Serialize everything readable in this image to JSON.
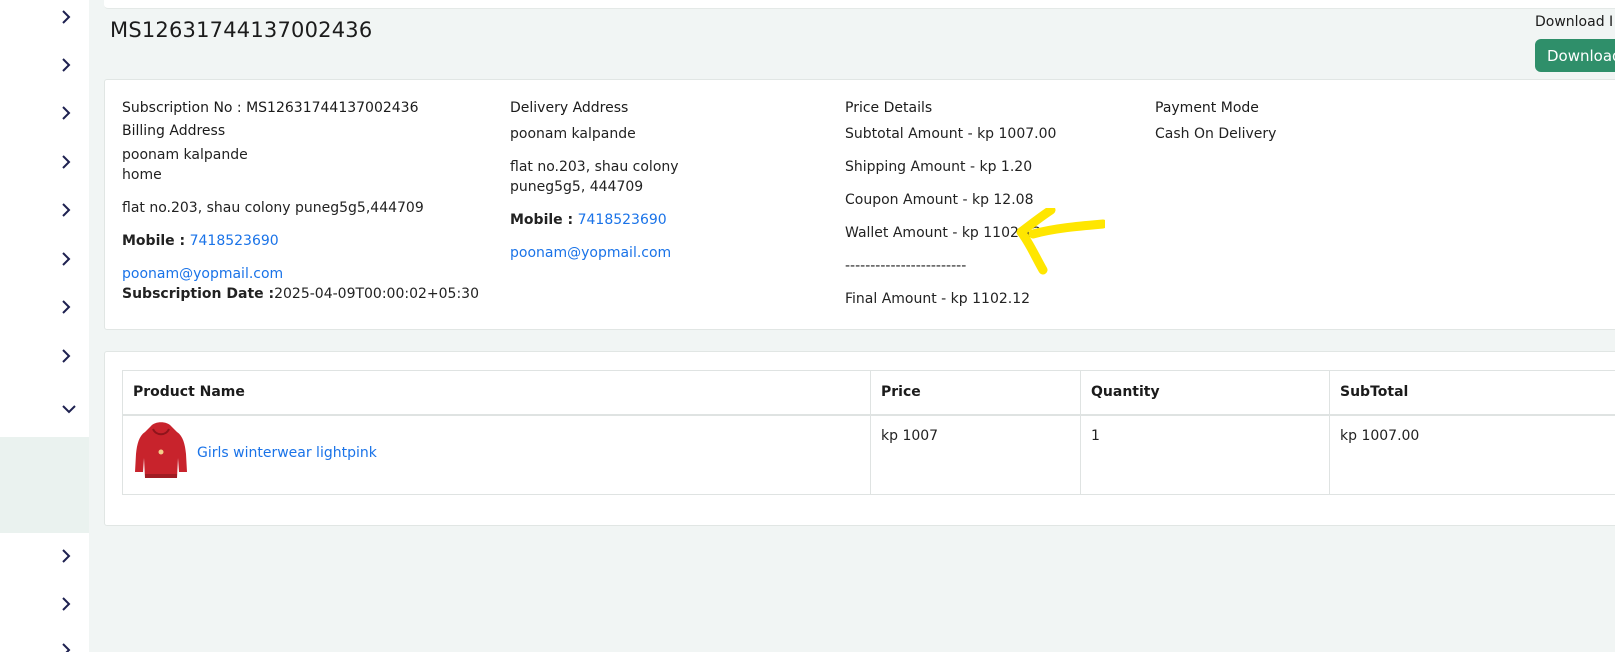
{
  "header": {
    "order_id": "MS12631744137002436",
    "download_label": "Download I",
    "download_button": "Download"
  },
  "billing": {
    "subscription_line": "Subscription No : MS12631744137002436",
    "billing_heading": "Billing Address",
    "name": "poonam kalpande",
    "address_type": "home",
    "address": "flat no.203, shau colony puneg5g5,444709",
    "mobile_label": "Mobile :",
    "mobile": "7418523690",
    "email": "poonam@yopmail.com",
    "date_label": "Subscription Date :",
    "date": "2025-04-09T00:00:02+05:30"
  },
  "delivery": {
    "heading": "Delivery Address",
    "name": "poonam kalpande",
    "address_line1": "flat no.203, shau colony",
    "address_line2": "puneg5g5, 444709",
    "mobile_label": "Mobile :",
    "mobile": "7418523690",
    "email": "poonam@yopmail.com"
  },
  "price": {
    "heading": "Price Details",
    "subtotal": "Subtotal Amount - kp 1007.00",
    "shipping": "Shipping Amount - kp 1.20",
    "coupon": "Coupon Amount - kp 12.08",
    "wallet": "Wallet Amount - kp 1102.12",
    "divider": "------------------------",
    "final": "Final Amount - kp  1102.12"
  },
  "payment": {
    "heading": "Payment Mode",
    "mode": "Cash On Delivery"
  },
  "table": {
    "headers": [
      "Product Name",
      "Price",
      "Quantity",
      "SubTotal"
    ],
    "rows": [
      {
        "product": "Girls winterwear lightpink",
        "price": "kp 1007",
        "quantity": "1",
        "subtotal": "kp 1007.00"
      }
    ]
  },
  "colors": {
    "accent_green": "#2f8f6a",
    "link_blue": "#1a73e8",
    "annotation_yellow": "#ffe600"
  },
  "icons": {
    "sidebar_collapsed": "chevron-right-icon",
    "sidebar_expanded": "chevron-down-icon",
    "annotation": "yellow-arrow-icon"
  }
}
